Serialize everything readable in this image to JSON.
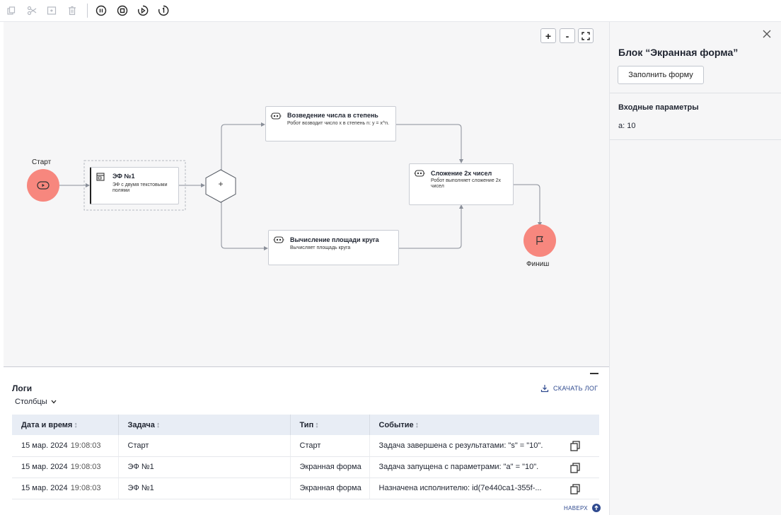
{
  "panel": {
    "title": "Блок “Экранная форма”",
    "fill_button": "Заполнить форму",
    "input_params_heading": "Входные параметры",
    "param_value": "a: 10"
  },
  "canvas": {
    "zoom_in": "+",
    "zoom_out": "-",
    "start_label": "Старт",
    "finish_label": "Финиш",
    "gateway_symbol": "+",
    "nodes": [
      {
        "title": "ЭФ №1",
        "desc": "ЭФ с двумя текстовыми полями",
        "icon": "form-icon"
      },
      {
        "title": "Возведение числа в степень",
        "desc": "Робот возводит число x в степень n: y = x^n.",
        "icon": "robot-icon"
      },
      {
        "title": "Вычисление площади круга",
        "desc": "Вычисляет площадь круга",
        "icon": "robot-icon"
      },
      {
        "title": "Сложение 2х чисел",
        "desc": "Робот выполняет сложение 2х чисел",
        "icon": "robot-icon"
      }
    ]
  },
  "logs": {
    "title": "Логи",
    "columns_button": "Столбцы",
    "download": "СКАЧАТЬ ЛОГ",
    "to_top": "НАВЕРХ",
    "headers": [
      "Дата и время",
      "Задача",
      "Тип",
      "Событие"
    ],
    "sort_glyph": "↕",
    "rows": [
      {
        "date": "15 мар. 2024",
        "time": "19:08:03",
        "task": "Старт",
        "type": "Старт",
        "event": "Задача завершена с результатами: \"s\" = \"10\"."
      },
      {
        "date": "15 мар. 2024",
        "time": "19:08:03",
        "task": "ЭФ №1",
        "type": "Экранная форма",
        "event": "Задача запущена с параметрами: \"a\" = \"10\"."
      },
      {
        "date": "15 мар. 2024",
        "time": "19:08:03",
        "task": "ЭФ №1",
        "type": "Экранная форма",
        "event": "Назначена исполнителю: id(7e440ca1-355f-..."
      }
    ]
  },
  "colors": {
    "accent": "#2f4a8f",
    "event_circle": "#f7877e",
    "table_header": "#e8edf5"
  }
}
